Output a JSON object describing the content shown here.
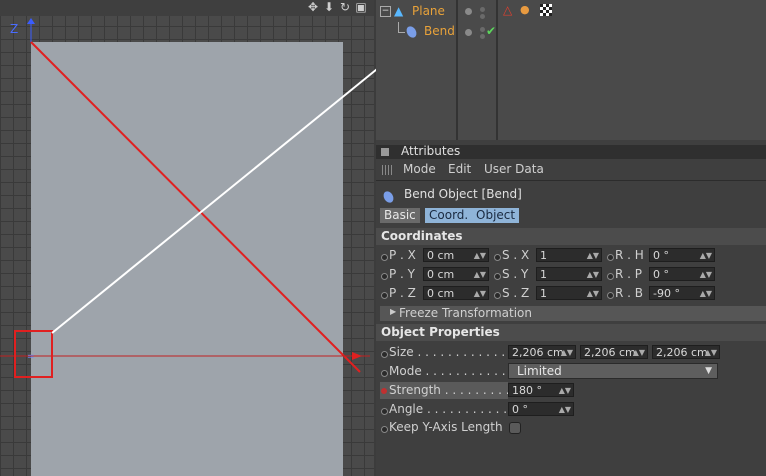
{
  "object_manager": {
    "objects": [
      {
        "name": "Plane"
      },
      {
        "name": "Bend"
      }
    ]
  },
  "viewport": {
    "axis_label": "Z"
  },
  "attributes": {
    "panel_title": "Attributes",
    "menu": [
      "Mode",
      "Edit",
      "User Data"
    ],
    "object_title": "Bend Object [Bend]",
    "tabs": [
      "Basic",
      "Coord.",
      "Object"
    ],
    "coordinates_title": "Coordinates",
    "coords": [
      {
        "label": "P . X",
        "value": "0 cm"
      },
      {
        "label": "P . Y",
        "value": "0 cm"
      },
      {
        "label": "P . Z",
        "value": "0 cm"
      },
      {
        "label": "S . X",
        "value": "1"
      },
      {
        "label": "S . Y",
        "value": "1"
      },
      {
        "label": "S . Z",
        "value": "1"
      },
      {
        "label": "R . H",
        "value": "0 °"
      },
      {
        "label": "R . P",
        "value": "0 °"
      },
      {
        "label": "R . B",
        "value": "-90 °"
      }
    ],
    "freeze_label": "Freeze Transformation",
    "object_props_title": "Object Properties",
    "size_label": "Size . . . . . . . . . . . . .",
    "size_values": [
      "2,206 cm",
      "2,206 cm",
      "2,206 cm"
    ],
    "mode_label": "Mode . . . . . . . . . . . .",
    "mode_value": "Limited",
    "strength_label": "Strength . . . . . . . . .",
    "strength_value": "180 °",
    "angle_label": "Angle . . . . . . . . . . . .",
    "angle_value": "0 °",
    "keep_label": "Keep Y-Axis Length"
  },
  "colors": {
    "accent_orange": "#e8a23a",
    "annotation_red": "#e02020",
    "tab_active": "#8fb4d8"
  }
}
